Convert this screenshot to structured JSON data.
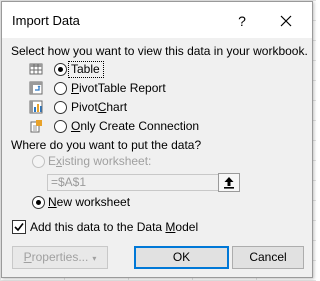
{
  "dialog": {
    "title": "Import Data",
    "help_label": "?",
    "view_prompt": "Select how you want to view this data in your workbook.",
    "view_options": [
      {
        "label": "Table",
        "selected": true,
        "icon": "table-icon"
      },
      {
        "label": "PivotTable Report",
        "selected": false,
        "icon": "pivottable-icon"
      },
      {
        "label": "PivotChart",
        "selected": false,
        "icon": "pivotchart-icon"
      },
      {
        "label": "Only Create Connection",
        "selected": false,
        "icon": "connection-icon"
      }
    ],
    "location_prompt": "Where do you want to put the data?",
    "existing_worksheet_label": "Existing worksheet:",
    "cell_reference_value": "=$A$1",
    "new_worksheet_label": "New worksheet",
    "data_model_label": "Add this data to the Data Model",
    "data_model_checked": true,
    "properties_label": "Properties...",
    "ok_label": "OK",
    "cancel_label": "Cancel"
  },
  "colors": {
    "dialog_bg": "#f0f0f0",
    "accent": "#0078d7",
    "disabled_text": "#a0a0a0"
  }
}
